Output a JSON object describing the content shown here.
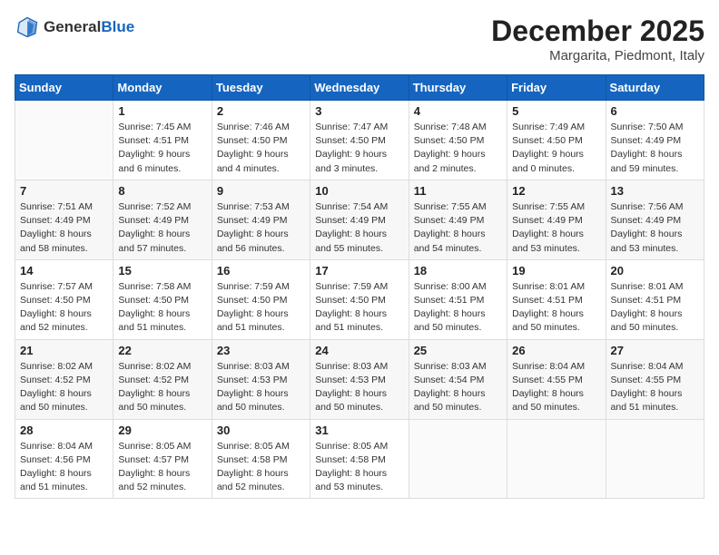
{
  "header": {
    "logo_general": "General",
    "logo_blue": "Blue",
    "month_title": "December 2025",
    "location": "Margarita, Piedmont, Italy"
  },
  "calendar": {
    "days_of_week": [
      "Sunday",
      "Monday",
      "Tuesday",
      "Wednesday",
      "Thursday",
      "Friday",
      "Saturday"
    ],
    "weeks": [
      [
        {
          "day": "",
          "info": ""
        },
        {
          "day": "1",
          "info": "Sunrise: 7:45 AM\nSunset: 4:51 PM\nDaylight: 9 hours\nand 6 minutes."
        },
        {
          "day": "2",
          "info": "Sunrise: 7:46 AM\nSunset: 4:50 PM\nDaylight: 9 hours\nand 4 minutes."
        },
        {
          "day": "3",
          "info": "Sunrise: 7:47 AM\nSunset: 4:50 PM\nDaylight: 9 hours\nand 3 minutes."
        },
        {
          "day": "4",
          "info": "Sunrise: 7:48 AM\nSunset: 4:50 PM\nDaylight: 9 hours\nand 2 minutes."
        },
        {
          "day": "5",
          "info": "Sunrise: 7:49 AM\nSunset: 4:50 PM\nDaylight: 9 hours\nand 0 minutes."
        },
        {
          "day": "6",
          "info": "Sunrise: 7:50 AM\nSunset: 4:49 PM\nDaylight: 8 hours\nand 59 minutes."
        }
      ],
      [
        {
          "day": "7",
          "info": "Sunrise: 7:51 AM\nSunset: 4:49 PM\nDaylight: 8 hours\nand 58 minutes."
        },
        {
          "day": "8",
          "info": "Sunrise: 7:52 AM\nSunset: 4:49 PM\nDaylight: 8 hours\nand 57 minutes."
        },
        {
          "day": "9",
          "info": "Sunrise: 7:53 AM\nSunset: 4:49 PM\nDaylight: 8 hours\nand 56 minutes."
        },
        {
          "day": "10",
          "info": "Sunrise: 7:54 AM\nSunset: 4:49 PM\nDaylight: 8 hours\nand 55 minutes."
        },
        {
          "day": "11",
          "info": "Sunrise: 7:55 AM\nSunset: 4:49 PM\nDaylight: 8 hours\nand 54 minutes."
        },
        {
          "day": "12",
          "info": "Sunrise: 7:55 AM\nSunset: 4:49 PM\nDaylight: 8 hours\nand 53 minutes."
        },
        {
          "day": "13",
          "info": "Sunrise: 7:56 AM\nSunset: 4:49 PM\nDaylight: 8 hours\nand 53 minutes."
        }
      ],
      [
        {
          "day": "14",
          "info": "Sunrise: 7:57 AM\nSunset: 4:50 PM\nDaylight: 8 hours\nand 52 minutes."
        },
        {
          "day": "15",
          "info": "Sunrise: 7:58 AM\nSunset: 4:50 PM\nDaylight: 8 hours\nand 51 minutes."
        },
        {
          "day": "16",
          "info": "Sunrise: 7:59 AM\nSunset: 4:50 PM\nDaylight: 8 hours\nand 51 minutes."
        },
        {
          "day": "17",
          "info": "Sunrise: 7:59 AM\nSunset: 4:50 PM\nDaylight: 8 hours\nand 51 minutes."
        },
        {
          "day": "18",
          "info": "Sunrise: 8:00 AM\nSunset: 4:51 PM\nDaylight: 8 hours\nand 50 minutes."
        },
        {
          "day": "19",
          "info": "Sunrise: 8:01 AM\nSunset: 4:51 PM\nDaylight: 8 hours\nand 50 minutes."
        },
        {
          "day": "20",
          "info": "Sunrise: 8:01 AM\nSunset: 4:51 PM\nDaylight: 8 hours\nand 50 minutes."
        }
      ],
      [
        {
          "day": "21",
          "info": "Sunrise: 8:02 AM\nSunset: 4:52 PM\nDaylight: 8 hours\nand 50 minutes."
        },
        {
          "day": "22",
          "info": "Sunrise: 8:02 AM\nSunset: 4:52 PM\nDaylight: 8 hours\nand 50 minutes."
        },
        {
          "day": "23",
          "info": "Sunrise: 8:03 AM\nSunset: 4:53 PM\nDaylight: 8 hours\nand 50 minutes."
        },
        {
          "day": "24",
          "info": "Sunrise: 8:03 AM\nSunset: 4:53 PM\nDaylight: 8 hours\nand 50 minutes."
        },
        {
          "day": "25",
          "info": "Sunrise: 8:03 AM\nSunset: 4:54 PM\nDaylight: 8 hours\nand 50 minutes."
        },
        {
          "day": "26",
          "info": "Sunrise: 8:04 AM\nSunset: 4:55 PM\nDaylight: 8 hours\nand 50 minutes."
        },
        {
          "day": "27",
          "info": "Sunrise: 8:04 AM\nSunset: 4:55 PM\nDaylight: 8 hours\nand 51 minutes."
        }
      ],
      [
        {
          "day": "28",
          "info": "Sunrise: 8:04 AM\nSunset: 4:56 PM\nDaylight: 8 hours\nand 51 minutes."
        },
        {
          "day": "29",
          "info": "Sunrise: 8:05 AM\nSunset: 4:57 PM\nDaylight: 8 hours\nand 52 minutes."
        },
        {
          "day": "30",
          "info": "Sunrise: 8:05 AM\nSunset: 4:58 PM\nDaylight: 8 hours\nand 52 minutes."
        },
        {
          "day": "31",
          "info": "Sunrise: 8:05 AM\nSunset: 4:58 PM\nDaylight: 8 hours\nand 53 minutes."
        },
        {
          "day": "",
          "info": ""
        },
        {
          "day": "",
          "info": ""
        },
        {
          "day": "",
          "info": ""
        }
      ]
    ]
  }
}
